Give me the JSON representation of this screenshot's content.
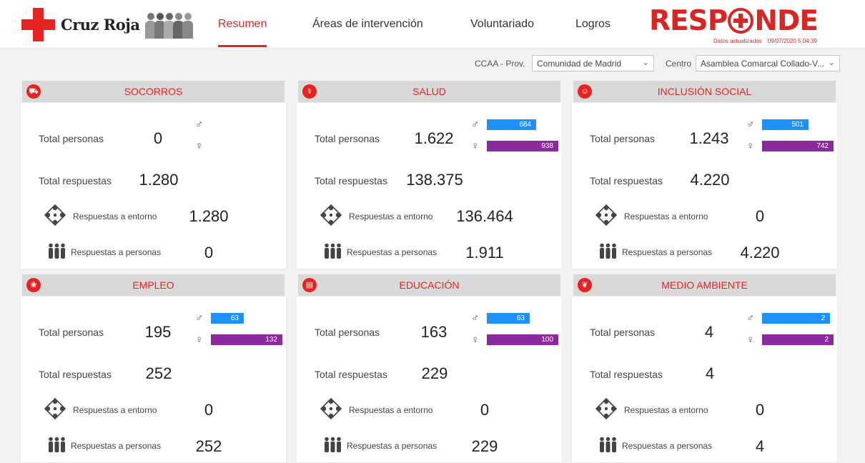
{
  "header": {
    "brand": "Cruz Roja",
    "responde": {
      "left": "RESP",
      "right": "NDE"
    },
    "updated_label": "Datos actualizados",
    "updated_value": "09/07/2020 5:04:39",
    "nav": [
      {
        "label": "Resumen",
        "active": true
      },
      {
        "label": "Áreas de intervención",
        "active": false
      },
      {
        "label": "Voluntariado",
        "active": false
      },
      {
        "label": "Logros",
        "active": false
      }
    ]
  },
  "filters": {
    "ccaa_label": "CCAA - Prov.",
    "ccaa_value": "Comunidad de Madrid",
    "centro_label": "Centro",
    "centro_value": "Asamblea Comarcal Collado-V..."
  },
  "labels": {
    "total_personas": "Total personas",
    "total_respuestas": "Total respuestas",
    "resp_entorno": "Respuestas a entorno",
    "resp_personas": "Respuestas a personas",
    "male_symbol": "♂",
    "female_symbol": "♀"
  },
  "colors": {
    "accent": "#e52421",
    "male": "#1e90ff",
    "female": "#8a2a9c"
  },
  "cards": [
    {
      "title": "SOCORROS",
      "icon": "ambulance-icon",
      "total_personas": "0",
      "male": "",
      "female": "",
      "male_frac": 0,
      "female_frac": 0,
      "total_respuestas": "1.280",
      "resp_entorno": "1.280",
      "resp_personas": "0"
    },
    {
      "title": "SALUD",
      "icon": "caduceus-icon",
      "total_personas": "1.622",
      "male": "684",
      "female": "938",
      "male_frac": 0.73,
      "female_frac": 1.0,
      "total_respuestas": "138.375",
      "resp_entorno": "136.464",
      "resp_personas": "1.911"
    },
    {
      "title": "INCLUSIÓN SOCIAL",
      "icon": "group-icon",
      "total_personas": "1.243",
      "male": "501",
      "female": "742",
      "male_frac": 0.68,
      "female_frac": 1.0,
      "total_respuestas": "4.220",
      "resp_entorno": "0",
      "resp_personas": "4.220"
    },
    {
      "title": "EMPLEO",
      "icon": "network-icon",
      "total_personas": "195",
      "male": "63",
      "female": "132",
      "male_frac": 0.48,
      "female_frac": 1.0,
      "total_respuestas": "252",
      "resp_entorno": "0",
      "resp_personas": "252"
    },
    {
      "title": "EDUCACIÓN",
      "icon": "book-icon",
      "total_personas": "163",
      "male": "63",
      "female": "100",
      "male_frac": 0.63,
      "female_frac": 1.0,
      "total_respuestas": "229",
      "resp_entorno": "0",
      "resp_personas": "229"
    },
    {
      "title": "MEDIO AMBIENTE",
      "icon": "leaf-icon",
      "total_personas": "4",
      "male": "2",
      "female": "2",
      "male_frac": 1.0,
      "female_frac": 1.0,
      "total_respuestas": "4",
      "resp_entorno": "0",
      "resp_personas": "4"
    }
  ]
}
